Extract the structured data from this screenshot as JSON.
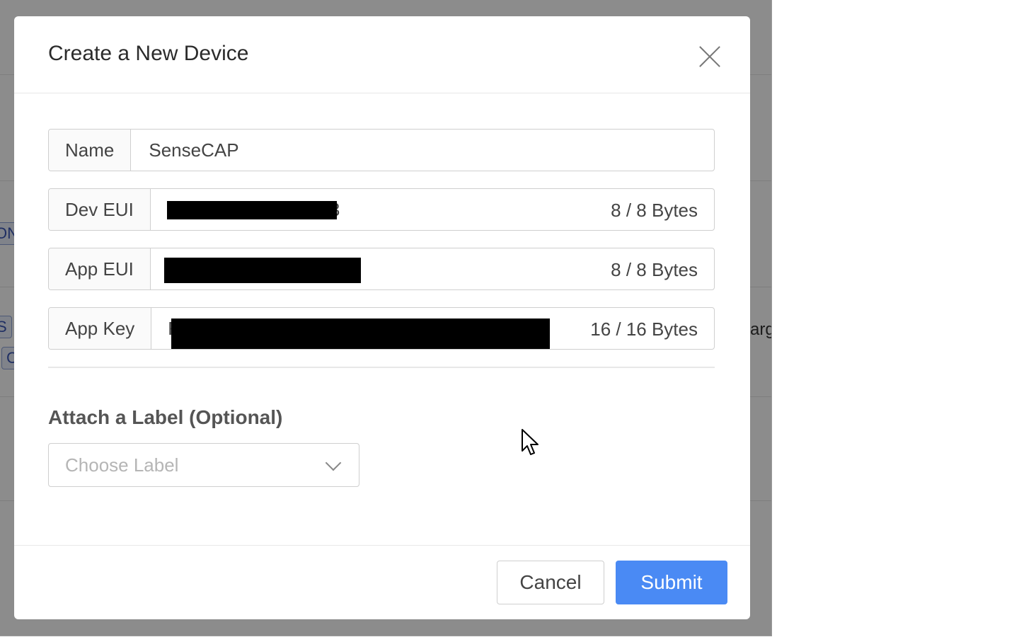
{
  "background": {
    "tags": [
      "ON",
      "S",
      "C"
    ],
    "fragment_text": "arg"
  },
  "modal": {
    "title": "Create a New Device",
    "fields": {
      "name": {
        "label": "Name",
        "value": "SenseCAP"
      },
      "dev_eui": {
        "label": "Dev EUI",
        "visible_tail": "3",
        "byte_count": "8 / 8 Bytes"
      },
      "app_eui": {
        "label": "App EUI",
        "byte_count": "8 / 8 Bytes"
      },
      "app_key": {
        "label": "App Key",
        "visible_head": "F",
        "byte_count": "16 / 16 Bytes"
      }
    },
    "label_section": {
      "title": "Attach a Label (Optional)",
      "placeholder": "Choose Label"
    },
    "footer": {
      "cancel_label": "Cancel",
      "submit_label": "Submit"
    }
  },
  "colors": {
    "submit": "#4a8af4",
    "overlay": "rgba(0,0,0,0.45)"
  },
  "icons": {
    "close": "close-icon",
    "dropdown": "chevron-down-icon",
    "cursor": "mouse-pointer-icon"
  }
}
